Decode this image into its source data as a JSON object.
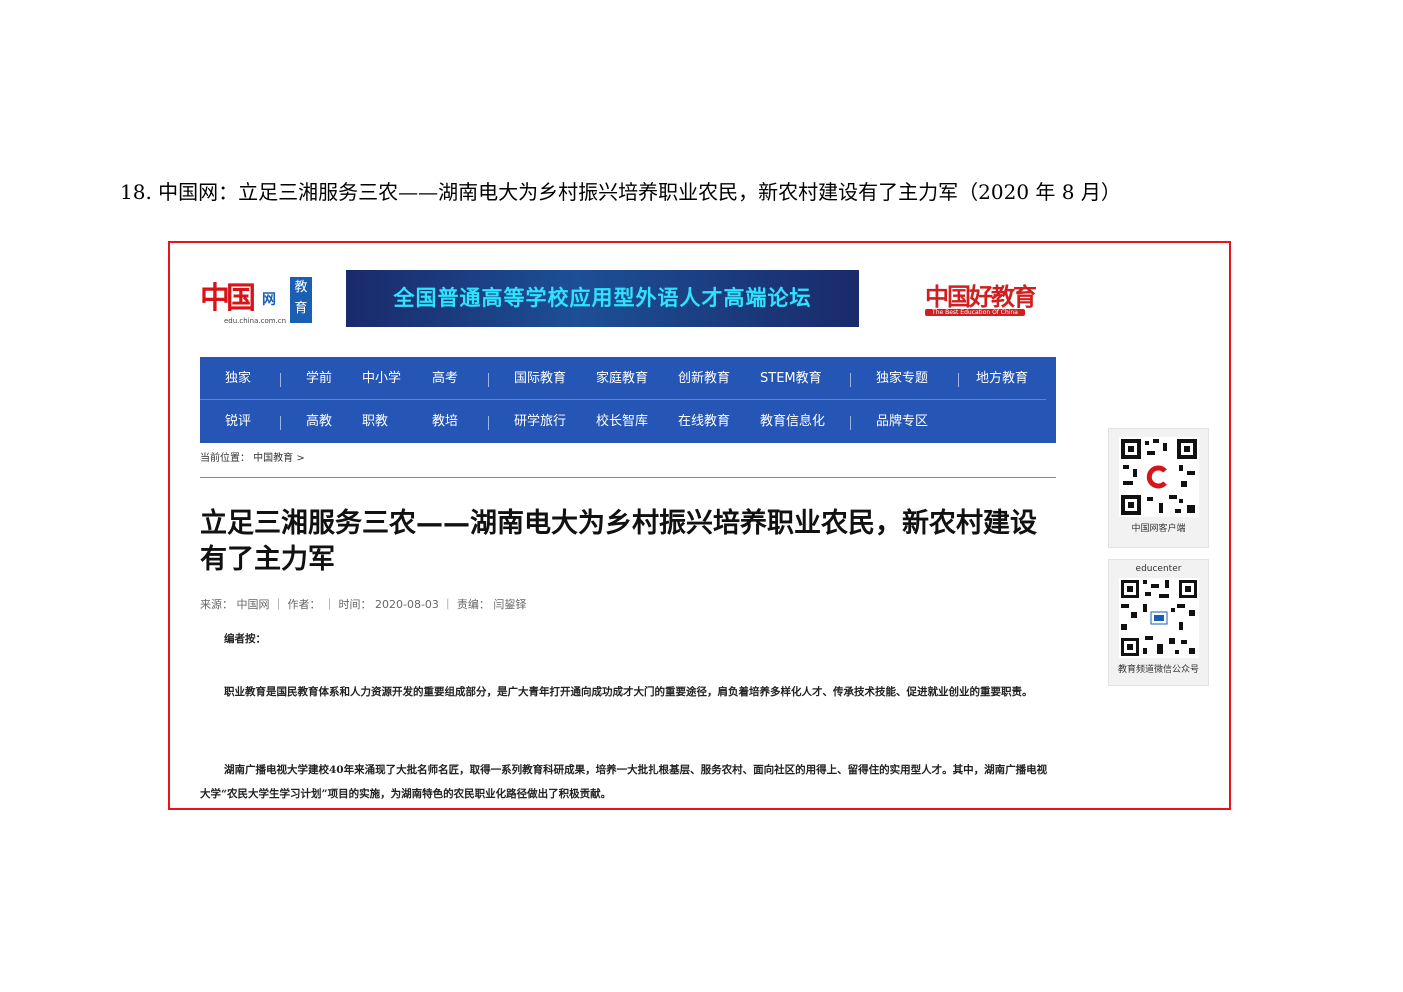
{
  "caption": "18. 中国网：立足三湘服务三农——湖南电大为乡村振兴培养职业农民，新农村建设有了主力军（2020 年 8 月）",
  "header": {
    "logo_mark": "中国",
    "logo_suffix": "网",
    "logo_url": "edu.china.com.cn",
    "logo_section": "教育",
    "banner_text": "全国普通高等学校应用型外语人才高端论坛",
    "good_edu": "中国好教育",
    "good_edu_sub": "The Best Education Of China"
  },
  "nav": {
    "row1": [
      "独家",
      "学前",
      "中小学",
      "高考",
      "国际教育",
      "家庭教育",
      "创新教育",
      "STEM教育",
      "独家专题",
      "地方教育"
    ],
    "row2": [
      "锐评",
      "高教",
      "职教",
      "教培",
      "研学旅行",
      "校长智库",
      "在线教育",
      "教育信息化",
      "品牌专区"
    ]
  },
  "breadcrumb": "当前位置： 中国教育 >",
  "article": {
    "title": "立足三湘服务三农——湖南电大为乡村振兴培养职业农民，新农村建设有了主力军",
    "meta": "来源： 中国网 ｜ 作者： ｜ 时间： 2020-08-03 ｜ 责编： 闫鋆铎",
    "editor_note": "编者按：",
    "para1": "职业教育是国民教育体系和人力资源开发的重要组成部分，是广大青年打开通向成功成才大门的重要途径，肩负着培养多样化人才、传承技术技能、促进就业创业的重要职责。",
    "para2": "湖南广播电视大学建校40年来涌现了大批名师名匠，取得一系列教育科研成果，培养一大批扎根基层、服务农村、面向社区的用得上、留得住的实用型人才。其中，湖南广播电视大学“农民大学生学习计划”项目的实施，为湖南特色的农民职业化路径做出了积极贡献。"
  },
  "sidebar": {
    "qr1_label": "中国网客户端",
    "qr2_top": "educenter",
    "qr2_label": "教育频道微信公众号"
  },
  "colors": {
    "nav_bg": "#2555b5",
    "frame_border": "#e8141b",
    "logo_red": "#d7141a",
    "banner_text": "#2fe3ff"
  }
}
